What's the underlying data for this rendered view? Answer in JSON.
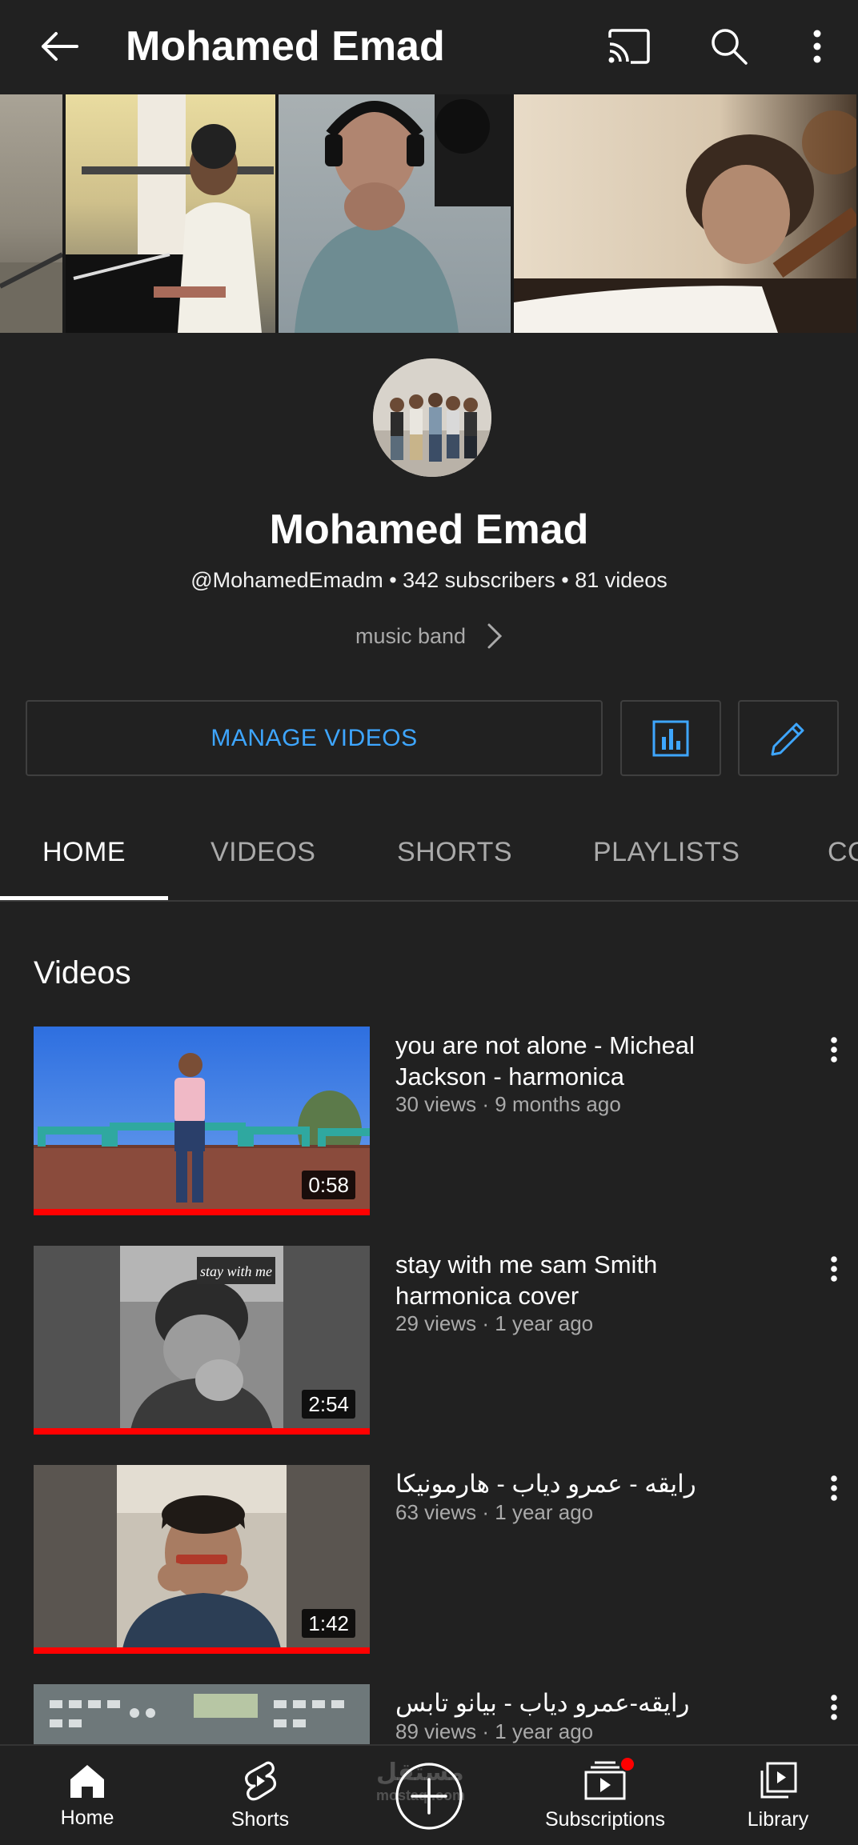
{
  "appbar": {
    "title": "Mohamed Emad",
    "icons": [
      "back-arrow-icon",
      "cast-icon",
      "search-icon",
      "more-vert-icon"
    ]
  },
  "channel": {
    "name": "Mohamed Emad",
    "meta": "@MohamedEmadm • 342 subscribers • 81 videos",
    "description": "music band"
  },
  "actions": {
    "manage_label": "MANAGE VIDEOS",
    "accent_color": "#3ea6ff"
  },
  "tabs": [
    {
      "label": "HOME",
      "active": true
    },
    {
      "label": "VIDEOS",
      "active": false
    },
    {
      "label": "SHORTS",
      "active": false
    },
    {
      "label": "PLAYLISTS",
      "active": false
    },
    {
      "label": "CO",
      "active": false
    }
  ],
  "section": {
    "title": "Videos"
  },
  "videos": [
    {
      "title": "you are not alone - Micheal Jackson - harmonica",
      "meta": "30 views · 9 months ago",
      "duration": "0:58",
      "watched": 1.0
    },
    {
      "title": "stay with me sam Smith harmonica cover",
      "meta": "29 views · 1 year ago",
      "duration": "2:54",
      "thumb_caption": "stay with me",
      "watched": 1.0
    },
    {
      "title": "رايقه - عمرو دياب - هارمونيكا",
      "meta": "63 views · 1 year ago",
      "duration": "1:42",
      "watched": 1.0
    },
    {
      "title": "رايقه-عمرو دياب - بيانو تابس",
      "meta": "89 views · 1 year ago",
      "duration": "",
      "watched": 0
    }
  ],
  "bottomnav": [
    {
      "label": "Home",
      "icon": "home-icon",
      "active": true
    },
    {
      "label": "Shorts",
      "icon": "shorts-icon",
      "active": false
    },
    {
      "label": "",
      "icon": "create-plus-icon",
      "active": false
    },
    {
      "label": "Subscriptions",
      "icon": "subscriptions-icon",
      "active": false,
      "badge": true
    },
    {
      "label": "Library",
      "icon": "library-icon",
      "active": false
    }
  ],
  "watermark": {
    "text": "مستقل",
    "sub": "mostaql.com"
  },
  "colors": {
    "background": "#212121",
    "progress": "#ff0000",
    "secondary_text": "#aaaaaa",
    "badge": "#ff0000"
  }
}
